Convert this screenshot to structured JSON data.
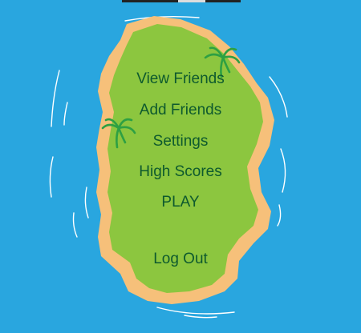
{
  "colors": {
    "water": "#29a6df",
    "sand": "#f6c07a",
    "grass": "#8cc63f",
    "text": "#0e5a2e",
    "palm": "#2ea043"
  },
  "menu": {
    "items": [
      {
        "label": "View Friends"
      },
      {
        "label": "Add Friends"
      },
      {
        "label": "Settings"
      },
      {
        "label": "High Scores"
      },
      {
        "label": "PLAY"
      },
      {
        "label": "Log Out"
      }
    ]
  },
  "icons": [
    "palm-tree-icon",
    "palm-tree-icon"
  ]
}
